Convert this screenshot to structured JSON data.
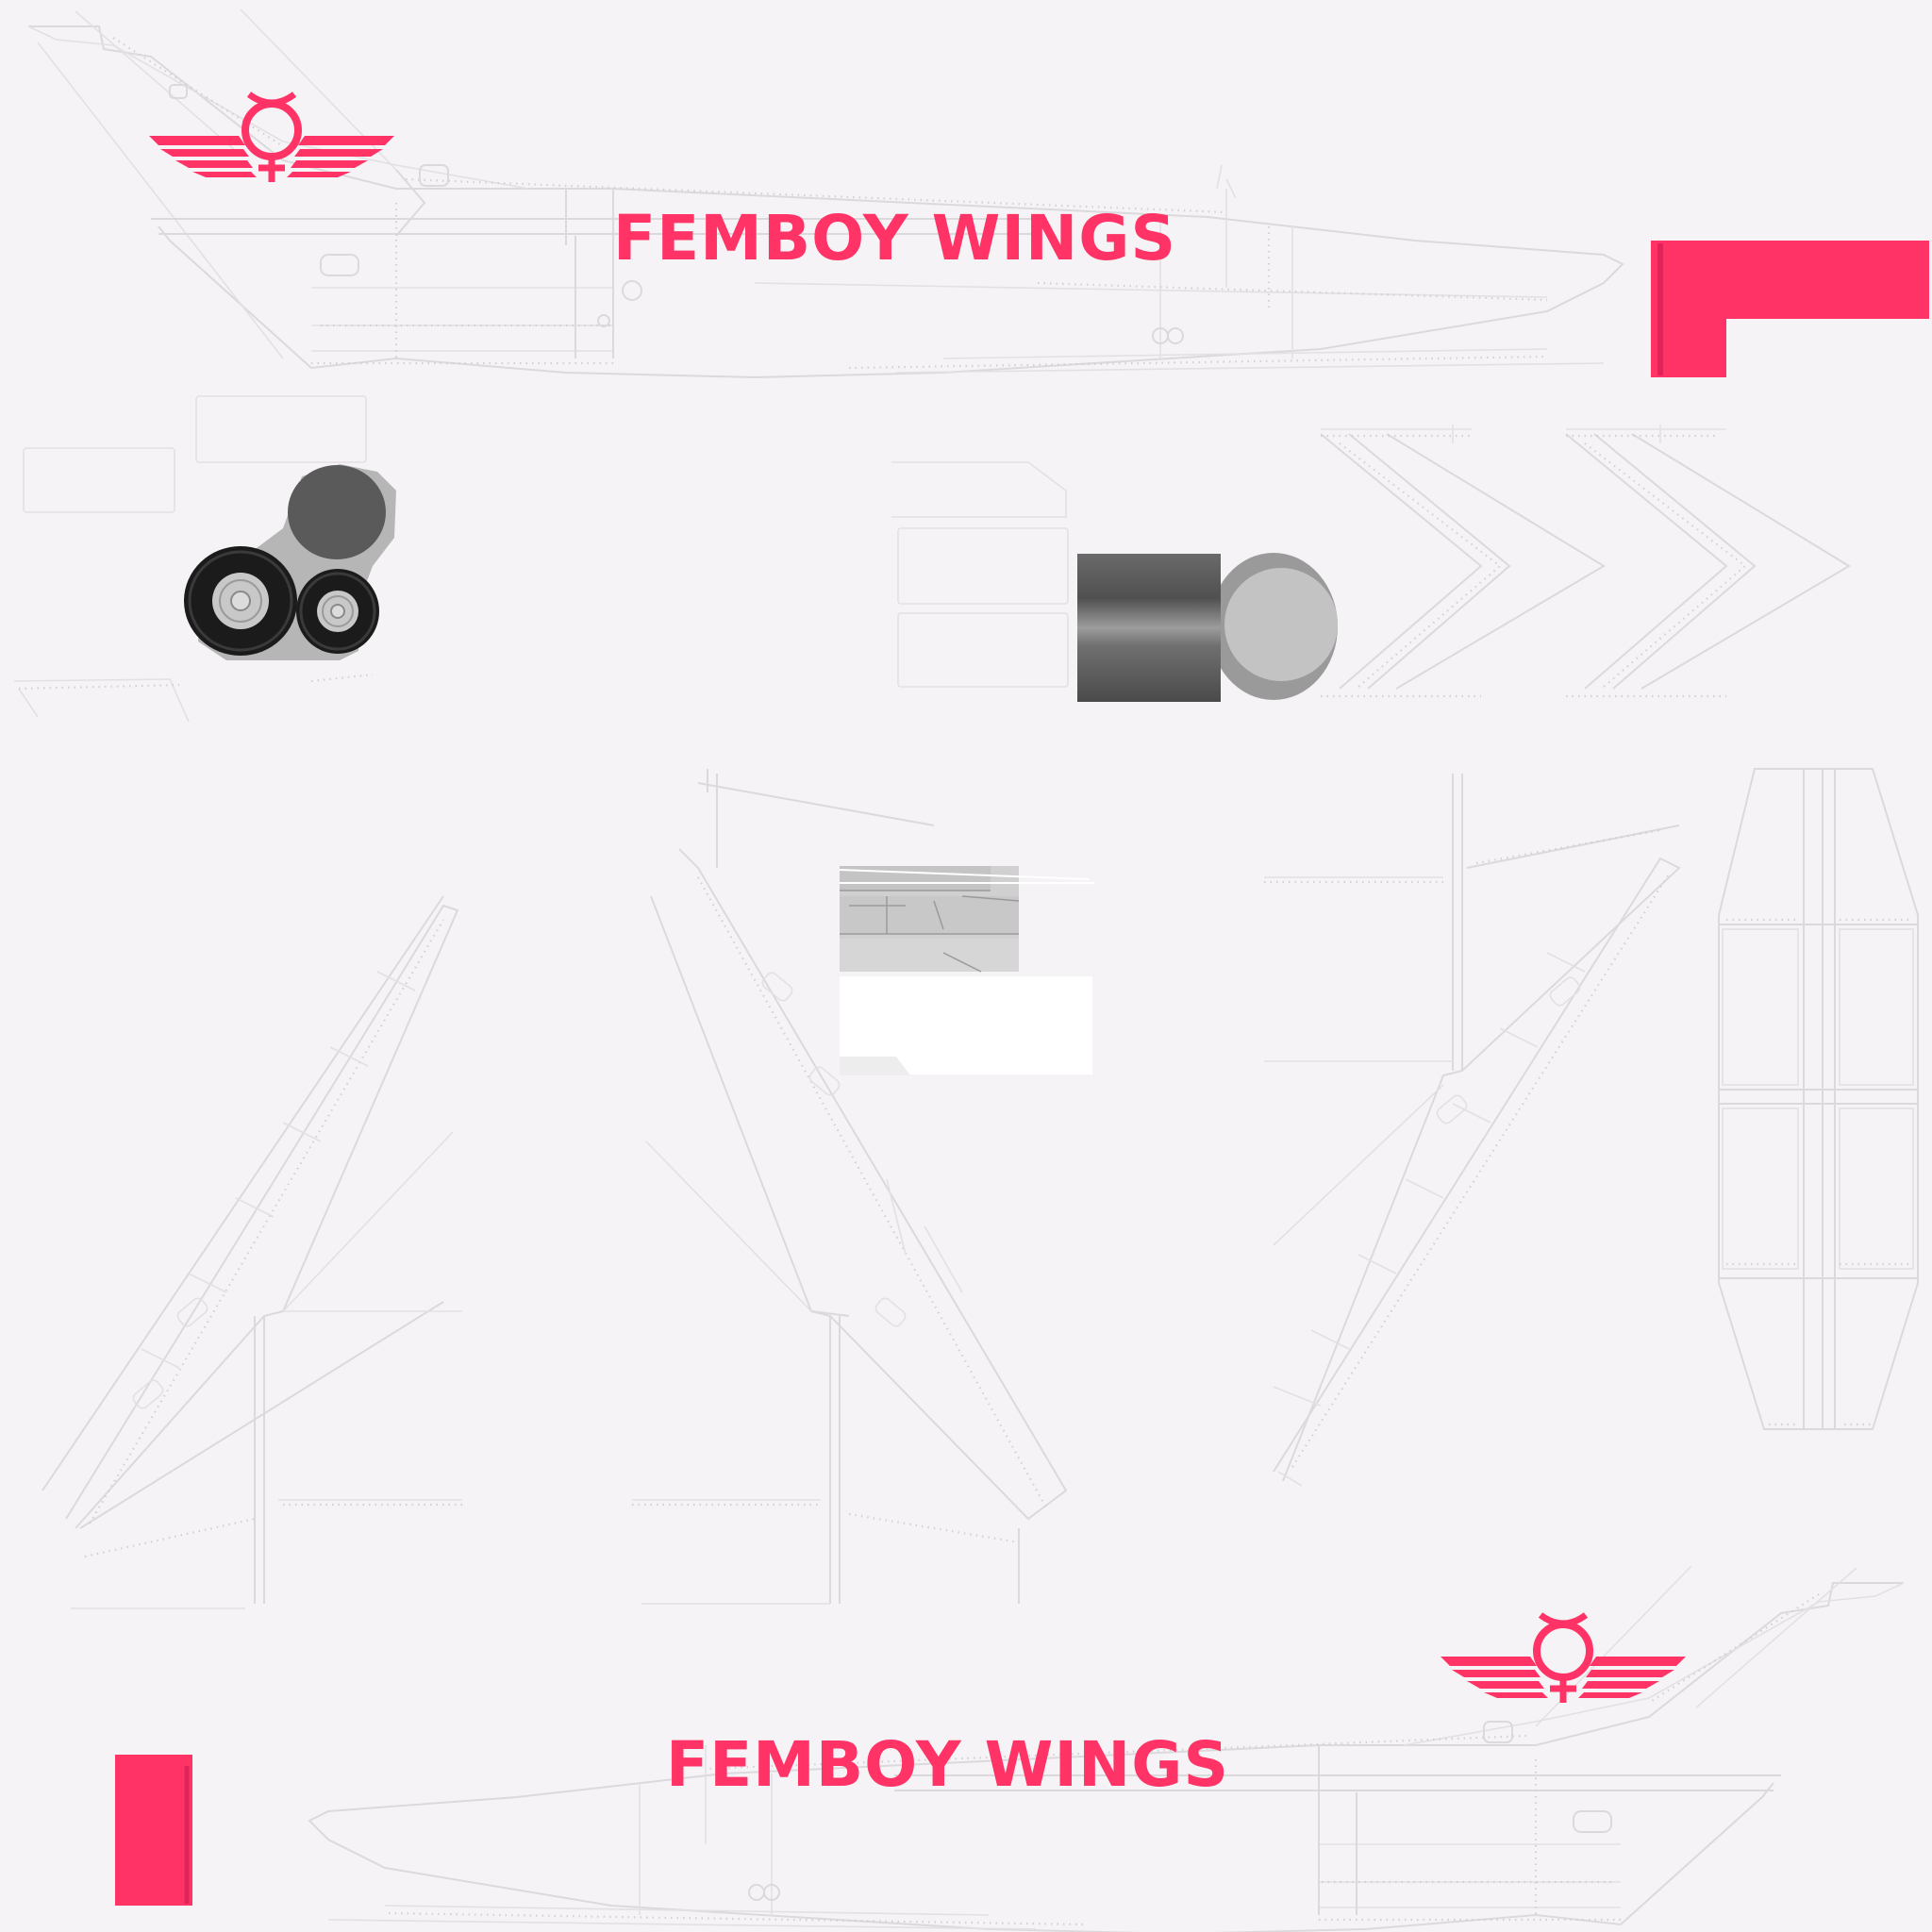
{
  "colors": {
    "brand": "#ff3366",
    "background": "#f6f3f6",
    "panel_line": "#dcd9dd",
    "tire": "#1b1b1b",
    "hub": "#c8c8c8",
    "gear_dark": "#5a5a5a",
    "engine_light": "#c3c3c3"
  },
  "livery": {
    "name_top": "FEMBOY WINGS",
    "name_bottom": "FEMBOY WINGS"
  },
  "icons": {
    "logo": "winged-circle-emblem-icon",
    "wheels": "landing-gear-wheels-icon",
    "engine": "engine-nacelle-icon"
  }
}
